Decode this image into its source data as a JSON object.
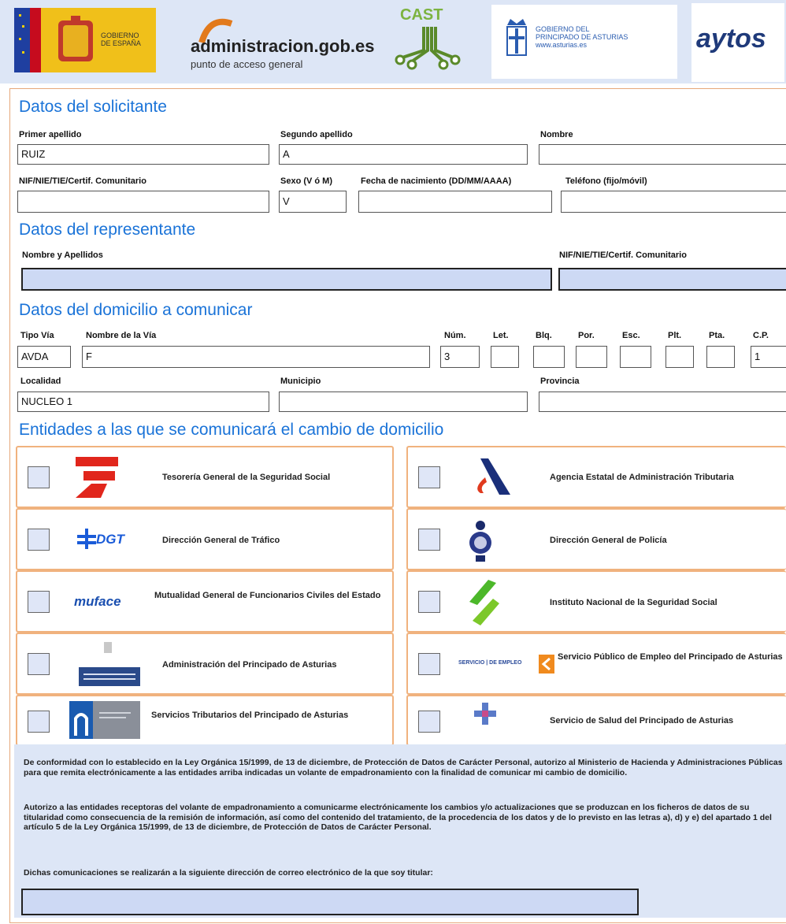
{
  "header": {
    "logos": {
      "gobierno_line1": "GOBIERNO",
      "gobierno_line2": "DE ESPAÑA",
      "administracion_main": "administracion.gob.es",
      "administracion_sub": "punto de acceso general",
      "cast": "CAST",
      "asturias_line1": "GOBIERNO DEL",
      "asturias_line2": "PRINCIPADO DE ASTURIAS",
      "asturias_line3": "www.asturias.es",
      "aytos": "aytos"
    }
  },
  "solicitante": {
    "title": "Datos del solicitante",
    "primer_apellido_label": "Primer apellido",
    "primer_apellido_value": "RUIZ",
    "segundo_apellido_label": "Segundo apellido",
    "segundo_apellido_value": "A",
    "nombre_label": "Nombre",
    "nombre_value": "",
    "nif_label": "NIF/NIE/TIE/Certif. Comunitario",
    "nif_value": "",
    "sexo_label": "Sexo (V ó M)",
    "sexo_value": "V",
    "fecha_label": "Fecha de nacimiento (DD/MM/AAAA)",
    "fecha_value": "",
    "telefono_label": "Teléfono (fijo/móvil)",
    "telefono_value": ""
  },
  "representante": {
    "title": "Datos del representante",
    "nombre_label": "Nombre y Apellidos",
    "nif_label": "NIF/NIE/TIE/Certif. Comunitario"
  },
  "domicilio": {
    "title": "Datos del domicilio a comunicar",
    "tipo_via_label": "Tipo Vía",
    "tipo_via_value": "AVDA",
    "nombre_via_label": "Nombre de la Vía",
    "nombre_via_value": "F",
    "num_label": "Núm.",
    "num_value": "3",
    "let_label": "Let.",
    "blq_label": "Blq.",
    "por_label": "Por.",
    "esc_label": "Esc.",
    "plt_label": "Plt.",
    "pta_label": "Pta.",
    "cp_label": "C.P.",
    "cp_value": "1",
    "localidad_label": "Localidad",
    "localidad_value": "NUCLEO 1",
    "municipio_label": "Municipio",
    "municipio_value": "",
    "provincia_label": "Provincia",
    "provincia_value": ""
  },
  "entidades": {
    "title": "Entidades a las que se comunicará el cambio de domicilio",
    "items": [
      {
        "name": "Tesorería General de la Seguridad Social",
        "logo_text": "",
        "icon": "tgss-logo-icon"
      },
      {
        "name": "Agencia Estatal de Administración Tributaria",
        "logo_text": "",
        "icon": "aeat-logo-icon"
      },
      {
        "name": "Dirección General de Tráfico",
        "logo_text": "DGT",
        "icon": "dgt-logo-icon"
      },
      {
        "name": "Dirección General de Policía",
        "logo_text": "",
        "icon": "policia-shield-icon"
      },
      {
        "name": "Mutualidad General de Funcionarios Civiles del Estado",
        "logo_text": "muface",
        "icon": "muface-logo-icon"
      },
      {
        "name": "Instituto Nacional de la Seguridad Social",
        "logo_text": "",
        "icon": "inss-logo-icon"
      },
      {
        "name": "Administración del Principado de Asturias",
        "logo_text": "",
        "icon": "asturias-gov-logo-icon"
      },
      {
        "name": "Servicio Público de Empleo del Principado de Asturias",
        "logo_text": "SERVICIO | DE EMPLEO",
        "icon": "empleo-logo-icon"
      },
      {
        "name": "Servicios Tributarios del Principado de Asturias",
        "logo_text": "",
        "icon": "tributarios-logo-icon"
      },
      {
        "name": "Servicio de Salud del Principado de Asturias",
        "logo_text": "",
        "icon": "salud-logo-icon"
      }
    ]
  },
  "consent": {
    "paragraph1": "De conformidad con lo establecido en la Ley Orgánica 15/1999, de 13 de diciembre, de Protección de Datos de Carácter Personal, autorizo al Ministerio de Hacienda y Administraciones Públicas para que remita electrónicamente a las entidades arriba indicadas un volante de empadronamiento con la finalidad de comunicar mi cambio de domicilio.",
    "paragraph2": "Autorizo a las entidades receptoras del volante de empadronamiento a comunicarme electrónicamente los cambios y/o actualizaciones que se produzcan en los ficheros de datos de su titularidad como consecuencia de la remisión de información, así como del contenido del tratamiento, de la procedencia de los datos y de lo previsto en las letras a), d) y e) del apartado 1 del artículo 5 de la Ley Orgánica 15/1999, de 13 de diciembre, de Protección de Datos de Carácter Personal.",
    "paragraph3": "Dichas comunicaciones se realizarán a la siguiente dirección de correo electrónico de la que soy titular:"
  },
  "colors": {
    "accent_title": "#1a73d8",
    "card_border": "#f0b27e",
    "field_blue": "#cdd9f4",
    "banner_bg": "#dde6f6"
  }
}
